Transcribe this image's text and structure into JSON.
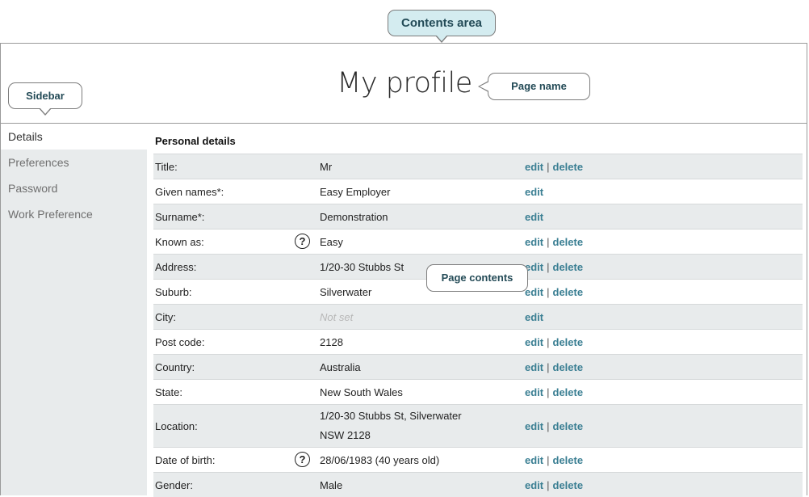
{
  "header": {
    "title": "My profile"
  },
  "callouts": {
    "contents_area": "Contents area",
    "sidebar": "Sidebar",
    "page_name": "Page name",
    "page_contents": "Page contents"
  },
  "sidebar": {
    "items": [
      {
        "label": "Details",
        "active": true
      },
      {
        "label": "Preferences",
        "active": false
      },
      {
        "label": "Password",
        "active": false
      },
      {
        "label": "Work Preference",
        "active": false
      }
    ]
  },
  "section": {
    "title": "Personal details"
  },
  "actions": {
    "edit": "edit",
    "delete": "delete",
    "separator": "|"
  },
  "help_icon_glyph": "?",
  "rows": [
    {
      "label": "Title:",
      "value": "Mr",
      "delete": true
    },
    {
      "label": "Given names*:",
      "value": "Easy Employer",
      "delete": false
    },
    {
      "label": "Surname*:",
      "value": "Demonstration",
      "delete": false
    },
    {
      "label": "Known as:",
      "value": "Easy",
      "delete": true,
      "help": true
    },
    {
      "label": "Address:",
      "value": "1/20-30 Stubbs St",
      "delete": true
    },
    {
      "label": "Suburb:",
      "value": "Silverwater",
      "delete": true
    },
    {
      "label": "City:",
      "value": "Not set",
      "delete": false,
      "unset": true
    },
    {
      "label": "Post code:",
      "value": "2128",
      "delete": true
    },
    {
      "label": "Country:",
      "value": "Australia",
      "delete": true
    },
    {
      "label": "State:",
      "value": "New South Wales",
      "delete": true
    },
    {
      "label": "Location:",
      "value": "1/20-30 Stubbs St, Silverwater",
      "value2": "NSW 2128",
      "delete": true
    },
    {
      "label": "Date of birth:",
      "value": "28/06/1983 (40 years old)",
      "delete": true,
      "help": true
    },
    {
      "label": "Gender:",
      "value": "Male",
      "delete": true
    }
  ]
}
